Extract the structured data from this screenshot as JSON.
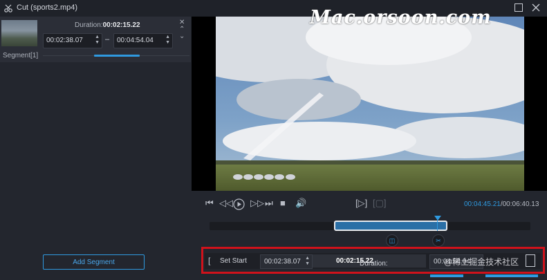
{
  "window": {
    "title": "Cut (sports2.mp4)",
    "maximize_icon": "square",
    "close_icon": "x"
  },
  "segment": {
    "label": "Segment[1]",
    "duration_label": "Duration:",
    "duration_value": "00:02:15.22",
    "start": "00:02:38.07",
    "end": "00:04:54.04",
    "separator": "–"
  },
  "left": {
    "add_segment": "Add Segment"
  },
  "video": {
    "watermark": "Mac.orsoon.com"
  },
  "playback": {
    "current_time": "00:04:45.21",
    "total_time": "/00:06:40.13"
  },
  "set_row": {
    "bracket": "[",
    "set_start": "Set Start",
    "start_value": "00:02:38.07",
    "duration_label": "Duration:",
    "duration_value": "00:02:15.22",
    "end_value_partial": "00:04:54.04",
    "overlay_text": "@稀土掘金技术社区"
  },
  "colors": {
    "accent": "#2f9ae0",
    "highlight": "#d0121b",
    "bg": "#23262e"
  }
}
